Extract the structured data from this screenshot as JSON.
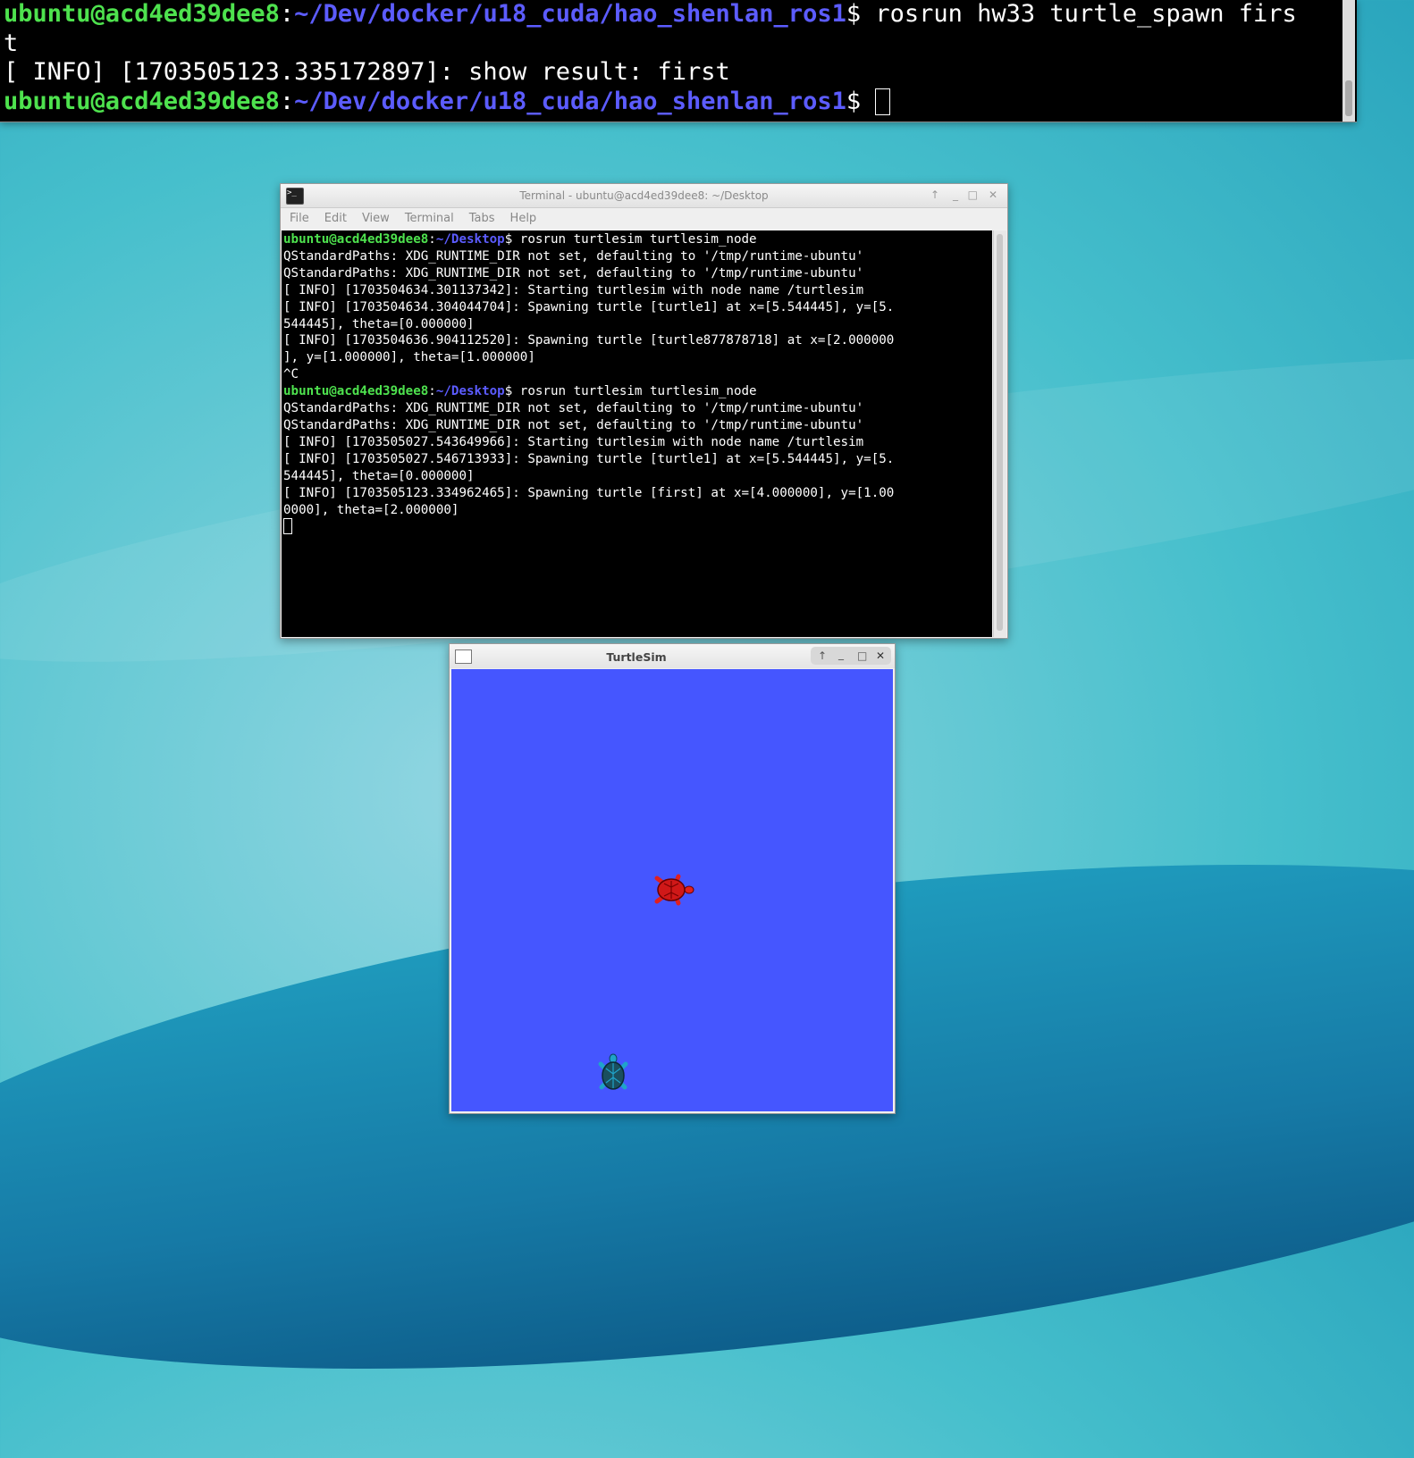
{
  "top_terminal": {
    "line1_prompt_user": "ubuntu@acd4ed39dee8",
    "line1_prompt_sep": ":",
    "line1_prompt_path": "~/Dev/docker/u18_cuda/hao_shenlan_ros1",
    "line1_prompt_dollar": "$",
    "line1_command": " rosrun hw33 turtle_spawn firs",
    "line2": "t",
    "line3": "[ INFO] [1703505123.335172897]: show result: first",
    "line4_prompt_user": "ubuntu@acd4ed39dee8",
    "line4_prompt_sep": ":",
    "line4_prompt_path": "~/Dev/docker/u18_cuda/hao_shenlan_ros1",
    "line4_prompt_dollar": "$ "
  },
  "middle_terminal": {
    "title": "Terminal - ubuntu@acd4ed39dee8: ~/Desktop",
    "menu": [
      "File",
      "Edit",
      "View",
      "Terminal",
      "Tabs",
      "Help"
    ],
    "prompt_user": "ubuntu@acd4ed39dee8",
    "prompt_sep": ":",
    "prompt_path": "~/Desktop",
    "prompt_dollar": "$",
    "cmd1": " rosrun turtlesim turtlesim_node",
    "lines_a": [
      "QStandardPaths: XDG_RUNTIME_DIR not set, defaulting to '/tmp/runtime-ubuntu'",
      "QStandardPaths: XDG_RUNTIME_DIR not set, defaulting to '/tmp/runtime-ubuntu'",
      "[ INFO] [1703504634.301137342]: Starting turtlesim with node name /turtlesim",
      "[ INFO] [1703504634.304044704]: Spawning turtle [turtle1] at x=[5.544445], y=[5.",
      "544445], theta=[0.000000]",
      "[ INFO] [1703504636.904112520]: Spawning turtle [turtle877878718] at x=[2.000000",
      "], y=[1.000000], theta=[1.000000]",
      "^C"
    ],
    "cmd2": " rosrun turtlesim turtlesim_node",
    "lines_b": [
      "QStandardPaths: XDG_RUNTIME_DIR not set, defaulting to '/tmp/runtime-ubuntu'",
      "QStandardPaths: XDG_RUNTIME_DIR not set, defaulting to '/tmp/runtime-ubuntu'",
      "[ INFO] [1703505027.543649966]: Starting turtlesim with node name /turtlesim",
      "[ INFO] [1703505027.546713933]: Spawning turtle [turtle1] at x=[5.544445], y=[5.",
      "544445], theta=[0.000000]",
      "[ INFO] [1703505123.334962465]: Spawning turtle [first] at x=[4.000000], y=[1.00",
      "0000], theta=[2.000000]"
    ]
  },
  "turtlesim": {
    "title": "TurtleSim",
    "background_color": "#4556ff",
    "turtle_red_color": "#e02020",
    "turtle_blue_color": "#1fa3c9"
  },
  "window_controls": {
    "up": "↑",
    "min": "_",
    "max": "□",
    "close": "✕"
  }
}
